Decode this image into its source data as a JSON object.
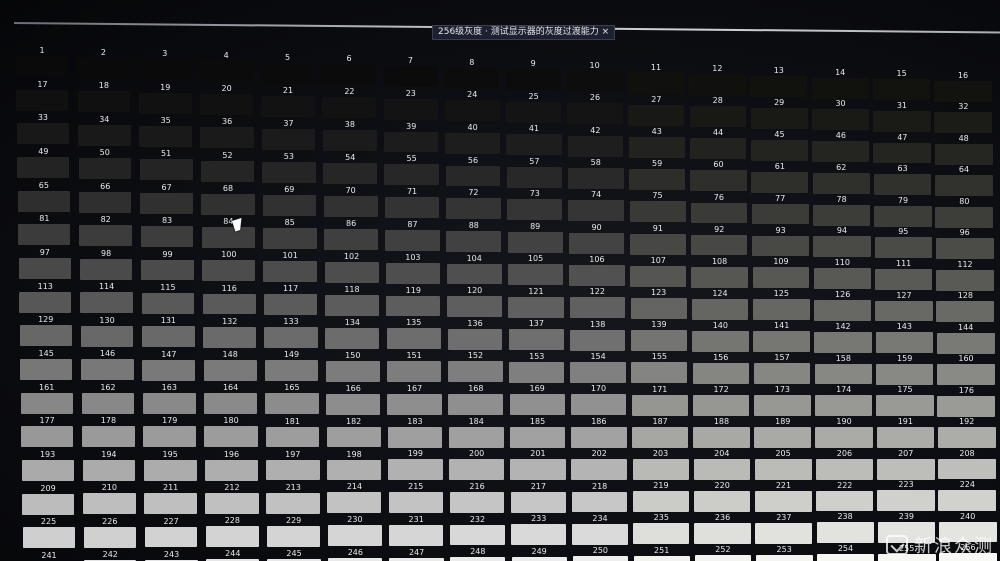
{
  "window_title": "256级灰度 · 测试显示器的灰度过渡能力 ×",
  "patch_count": 256,
  "patch_numbers_start": 1,
  "columns": 16,
  "rows": 16,
  "watermark": {
    "icon": "check-box-icon",
    "text": "新浪众测"
  },
  "colors": {
    "background": "#0b0d12",
    "label_text": "#e9e9ea"
  }
}
